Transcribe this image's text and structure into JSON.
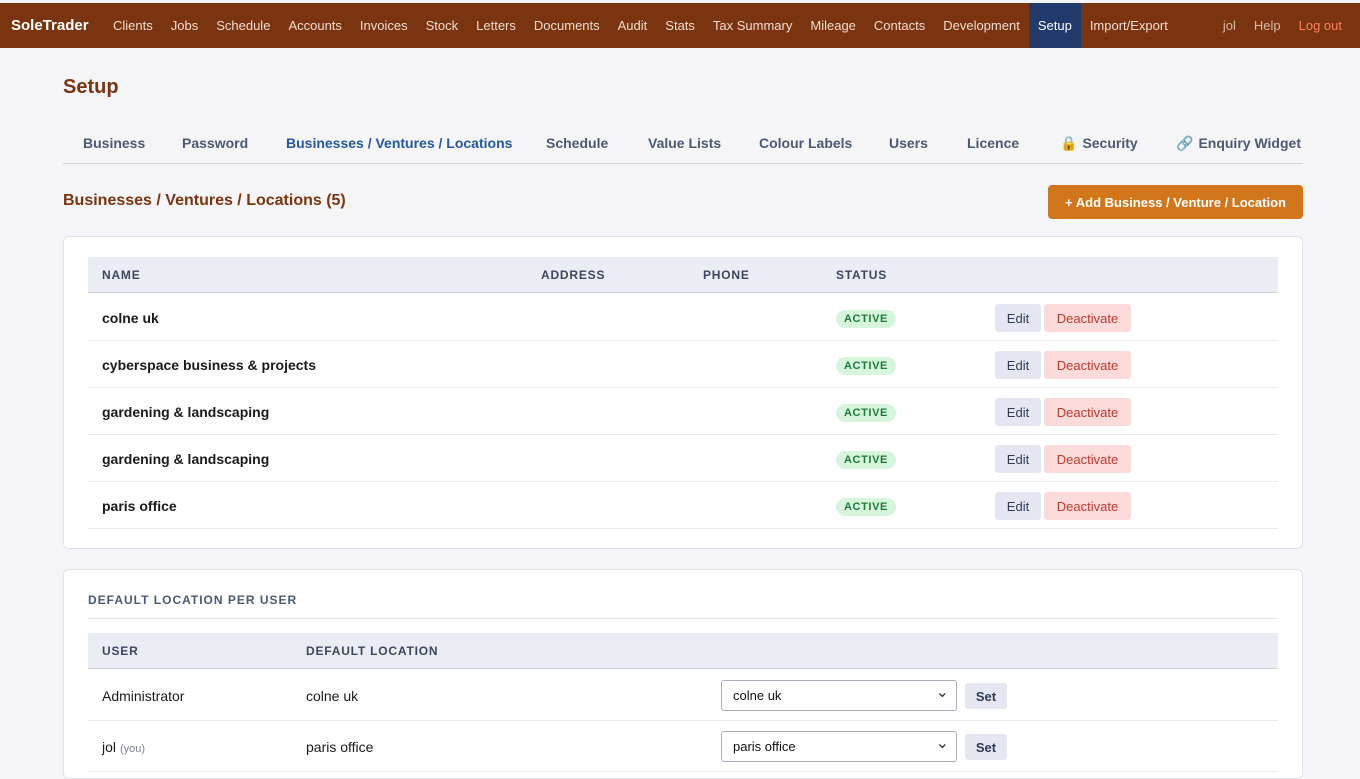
{
  "app": {
    "brand": "SoleTrader"
  },
  "nav": {
    "items": [
      "Clients",
      "Jobs",
      "Schedule",
      "Accounts",
      "Invoices",
      "Stock",
      "Letters",
      "Documents",
      "Audit",
      "Stats",
      "Tax Summary",
      "Mileage",
      "Contacts",
      "Development",
      "Setup",
      "Import/Export"
    ],
    "active": "Setup",
    "user": "jol",
    "help": "Help",
    "logout": "Log out"
  },
  "page": {
    "title": "Setup"
  },
  "tabs": {
    "items": [
      {
        "label": "Business",
        "icon": ""
      },
      {
        "label": "Password",
        "icon": ""
      },
      {
        "label": "Businesses / Ventures / Locations",
        "icon": ""
      },
      {
        "label": "Schedule",
        "icon": ""
      },
      {
        "label": "Value Lists",
        "icon": ""
      },
      {
        "label": "Colour Labels",
        "icon": ""
      },
      {
        "label": "Users",
        "icon": ""
      },
      {
        "label": "Licence",
        "icon": ""
      },
      {
        "label": "Security",
        "icon": "🔒"
      },
      {
        "label": "Enquiry Widget",
        "icon": "🔗"
      }
    ],
    "active": "Businesses / Ventures / Locations"
  },
  "locations": {
    "title": "Businesses / Ventures / Locations (5)",
    "add_label": "+ Add Business / Venture / Location",
    "columns": [
      "NAME",
      "ADDRESS",
      "PHONE",
      "STATUS"
    ],
    "rows": [
      {
        "name": "colne uk",
        "address": "",
        "phone": "",
        "status": "ACTIVE"
      },
      {
        "name": "cyberspace business & projects",
        "address": "",
        "phone": "",
        "status": "ACTIVE"
      },
      {
        "name": "gardening & landscaping",
        "address": "",
        "phone": "",
        "status": "ACTIVE"
      },
      {
        "name": "gardening & landscaping",
        "address": "",
        "phone": "",
        "status": "ACTIVE"
      },
      {
        "name": "paris office",
        "address": "",
        "phone": "",
        "status": "ACTIVE"
      }
    ],
    "edit_label": "Edit",
    "deactivate_label": "Deactivate"
  },
  "defaults": {
    "title": "DEFAULT LOCATION PER USER",
    "columns": [
      "USER",
      "DEFAULT LOCATION"
    ],
    "rows": [
      {
        "user": "Administrator",
        "you": "",
        "location": "colne uk",
        "selected": "colne uk"
      },
      {
        "user": "jol",
        "you": "(you)",
        "location": "paris office",
        "selected": "paris office"
      }
    ],
    "set_label": "Set"
  }
}
